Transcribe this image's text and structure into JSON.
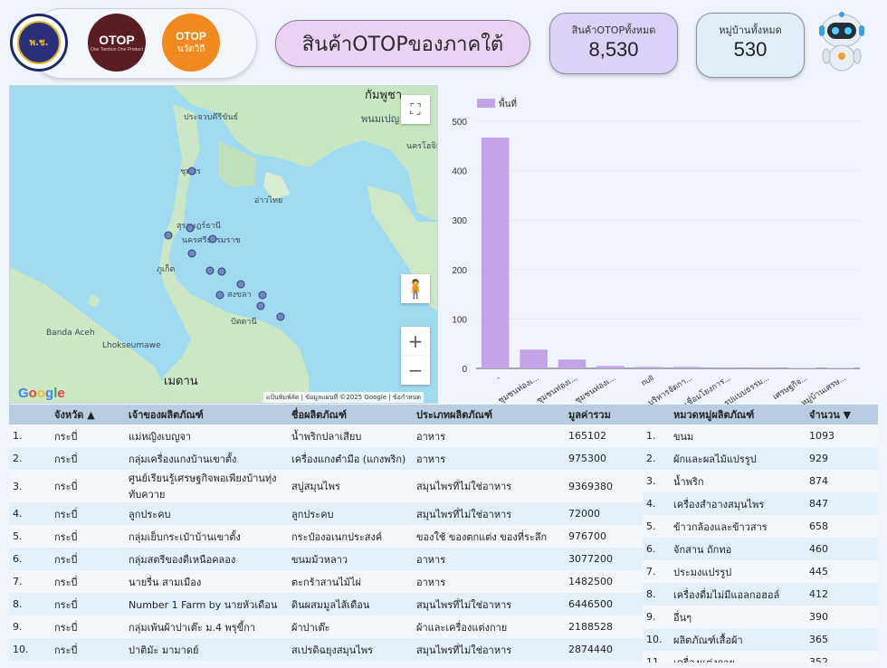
{
  "header": {
    "title": "สินค้าOTOPของภาคใต้",
    "logos": {
      "logo1_text": "พ.ช.",
      "logo2_text": "OTOP",
      "logo2_sub": "One Tambon One Product",
      "logo3_text": "OTOP",
      "logo3_sub": "นวัตวิถี"
    },
    "kpi_products": {
      "label": "สินค้าOTOPทั้งหมด",
      "value": "8,530"
    },
    "kpi_villages": {
      "label": "หมู่บ้านทั้งหมด",
      "value": "530"
    }
  },
  "map": {
    "labels": [
      "กัมพูชา",
      "พนมเปญ",
      "นครโฮจิมินห์",
      "ประจวบคีรีขันธ์",
      "ชุมพร",
      "สุราษฎร์ธานี",
      "นครศรีธรรมราช",
      "ภูเก็ต",
      "สงขลา",
      "ปัตตานี",
      "เมดาน",
      "อ่าวไทย",
      "Banda Aceh",
      "Lhokseumawe"
    ],
    "attribution": "แป้นพิมพ์ลัด | ข้อมูลแผนที่ ©2025 Google | ข้อกำหนด",
    "google_logo": "Google",
    "controls": {
      "fullscreen": "⛶",
      "zoom_in": "+",
      "zoom_out": "−",
      "pegman": "🧍"
    }
  },
  "chart_data": {
    "type": "bar",
    "legend": "พื้นที่",
    "categories": [
      "-",
      "ชุมชนท่องเ...",
      "ชุมชนท่องเ...",
      "ชุมชนท่องเ...",
      "null",
      "บริหารจัดกา...",
      "เชื่อมโยงการ...",
      "รูปแบบธรรม...",
      "เศรษฐกิจ...",
      "หมู่บ้านเศรษ..."
    ],
    "values": [
      467,
      38,
      18,
      5,
      3,
      3,
      2,
      2,
      1,
      1
    ],
    "ylim": [
      0,
      500
    ],
    "yticks": [
      0,
      100,
      200,
      300,
      400,
      500
    ],
    "color": "#c3a4e8"
  },
  "products_table": {
    "columns": [
      "",
      "จังหวัด",
      "เจ้าของผลิตภัณฑ์",
      "ชื่อผลิตภัณฑ์",
      "ประเภทผลิตภัณฑ์",
      "มูลค่ารวม"
    ],
    "sort_indicator": "▲",
    "rows": [
      [
        "1.",
        "กระบี่",
        "แม่หญิงเบญจา",
        "น้ำพริกปลาเสียบ",
        "อาหาร",
        "165102"
      ],
      [
        "2.",
        "กระบี่",
        "กลุ่มเครื่องแกงบ้านเขาตั้ง",
        "เครื่องแกงตำมือ (แกงพริก)",
        "อาหาร",
        "975300"
      ],
      [
        "3.",
        "กระบี่",
        "ศูนย์เรียนรู้เศรษฐกิจพอเพียงบ้านทุ่งทับควาย",
        "สบู่สมุนไพร",
        "สมุนไพรที่ไม่ใช่อาหาร",
        "9369380"
      ],
      [
        "4.",
        "กระบี่",
        "ลูกประคบ",
        "ลูกประคบ",
        "สมุนไพรที่ไม่ใช่อาหาร",
        "72000"
      ],
      [
        "5.",
        "กระบี่",
        "กลุ่มเย็บกระเป๋าบ้านเขาตั้ง",
        "กระป๋องอเนกประสงค์",
        "ของใช้ ของตกแต่ง ของที่ระลึก",
        "976700"
      ],
      [
        "6.",
        "กระบี่",
        "กลุ่มสตรีของดีเหนือคลอง",
        "ขนมม้วหลาว",
        "อาหาร",
        "3077200"
      ],
      [
        "7.",
        "กระบี่",
        "นายรื่น สามเมือง",
        "ตะกร้าสานไม้ไผ่",
        "อาหาร",
        "1482500"
      ],
      [
        "8.",
        "กระบี่",
        "Number 1 Farm by นายหัวเดือน",
        "ดินผสมมูลไส้เดือน",
        "สมุนไพรที่ไม่ใช่อาหาร",
        "6446500"
      ],
      [
        "9.",
        "กระบี่",
        "กลุ่มเพ้นผ้าปาเต๊ะ ม.4 พรุขี้กา",
        "ผ้าปาเต๊ะ",
        "ผ้าและเครื่องแต่งกาย",
        "2188528"
      ],
      [
        "10.",
        "กระบี่",
        "ปาติมัะ มามาดย์",
        "สเปรดิฉยุงสมุนไพร",
        "สมุนไพรที่ไม่ใช่อาหาร",
        "2874440"
      ]
    ]
  },
  "category_table": {
    "columns": [
      "",
      "หมวดหมู่ผลิตภัณฑ์",
      "จำนวน"
    ],
    "sort_indicator": "▼",
    "rows": [
      [
        "1.",
        "ขนม",
        "1093"
      ],
      [
        "2.",
        "ผักและผลไม้แปรรูป",
        "929"
      ],
      [
        "3.",
        "น้ำพริก",
        "874"
      ],
      [
        "4.",
        "เครื่องสำอางสมุนไพร",
        "847"
      ],
      [
        "5.",
        "ข้าวกล้องและข้าวสาร",
        "658"
      ],
      [
        "6.",
        "จักสาน ถักทอ",
        "460"
      ],
      [
        "7.",
        "ประมงแปรรูป",
        "445"
      ],
      [
        "8.",
        "เครื่องดื่มไม่มีแอลกอฮอล์",
        "412"
      ],
      [
        "9.",
        "อื่นๆ",
        "390"
      ],
      [
        "10.",
        "ผลิตภัณฑ์เสื้อผ้า",
        "365"
      ],
      [
        "11.",
        "เครื่องแต่งกาย",
        "352"
      ]
    ]
  },
  "colors": {
    "accent_purple": "#dcd1f7",
    "header_row": "#b9cce0",
    "bar": "#c3a4e8"
  }
}
